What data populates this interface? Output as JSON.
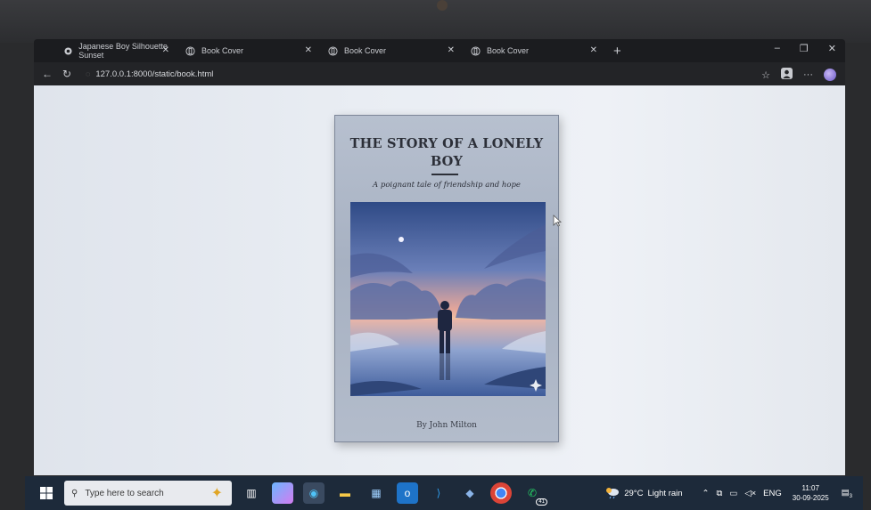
{
  "browser": {
    "tabs": [
      {
        "title": "Japanese Boy Silhouette Sunset",
        "icon": "image-favicon-icon"
      },
      {
        "title": "Book Cover",
        "icon": "page-favicon-icon"
      },
      {
        "title": "Book Cover",
        "icon": "page-favicon-icon"
      },
      {
        "title": "Book Cover",
        "icon": "page-favicon-icon"
      }
    ],
    "new_tab_label": "+",
    "url": "127.0.0.1:8000/static/book.html"
  },
  "book": {
    "title": "THE STORY OF A LONELY BOY",
    "subtitle": "A poignant tale of friendship and hope",
    "author": "By John Milton"
  },
  "taskbar": {
    "search_placeholder": "Type here to search",
    "whatsapp_badge": "41",
    "weather_temp": "29°C",
    "weather_desc": "Light rain",
    "language": "ENG",
    "time": "11:07",
    "date": "30-09-2025",
    "notification_count": "3"
  },
  "colors": {
    "page_bg": "#e9edf3",
    "cover_bg": "#b3bccb",
    "title_ink": "#2c2f38",
    "taskbar_bg": "#1d2a3a"
  }
}
